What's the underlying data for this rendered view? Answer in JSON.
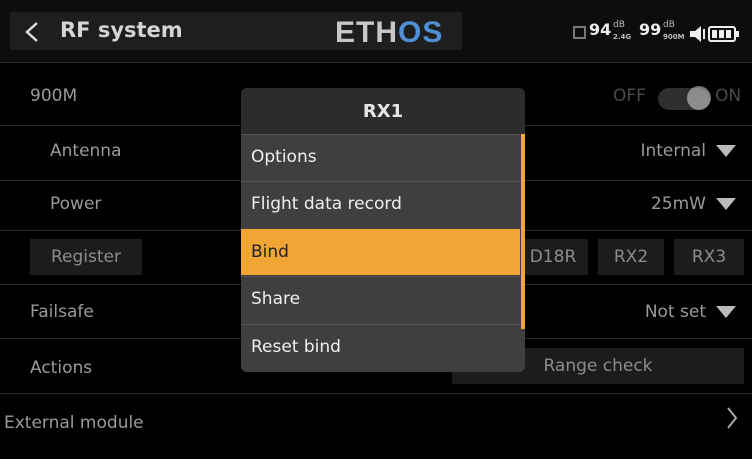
{
  "header": {
    "title": "RF system",
    "logo_main": "ETH",
    "logo_accent": "OS",
    "signal1": {
      "value": "94",
      "unit": "dB",
      "band": "2.4G"
    },
    "signal2": {
      "value": "99",
      "unit": "dB",
      "band": "900M"
    }
  },
  "rows": {
    "module_900m": {
      "label": "900M",
      "toggle_off": "OFF",
      "toggle_on": "ON"
    },
    "antenna": {
      "label": "Antenna",
      "value": "Internal"
    },
    "power": {
      "label": "Power",
      "value": "25mW"
    },
    "register": {
      "label": "Register",
      "partial_receiver": "D18R",
      "rx2": "RX2",
      "rx3": "RX3"
    },
    "failsafe": {
      "label": "Failsafe",
      "value": "Not set"
    },
    "actions": {
      "label": "Actions",
      "range_check": "Range check"
    },
    "external_module": {
      "label": "External module"
    }
  },
  "modal": {
    "title": "RX1",
    "items": [
      {
        "label": "Options"
      },
      {
        "label": "Flight data record"
      },
      {
        "label": "Bind"
      },
      {
        "label": "Share"
      },
      {
        "label": "Reset bind"
      }
    ],
    "selected": "Bind"
  },
  "colors": {
    "accent": "#f1a534",
    "logo_accent": "#4e8fd6",
    "background": "#000000"
  }
}
